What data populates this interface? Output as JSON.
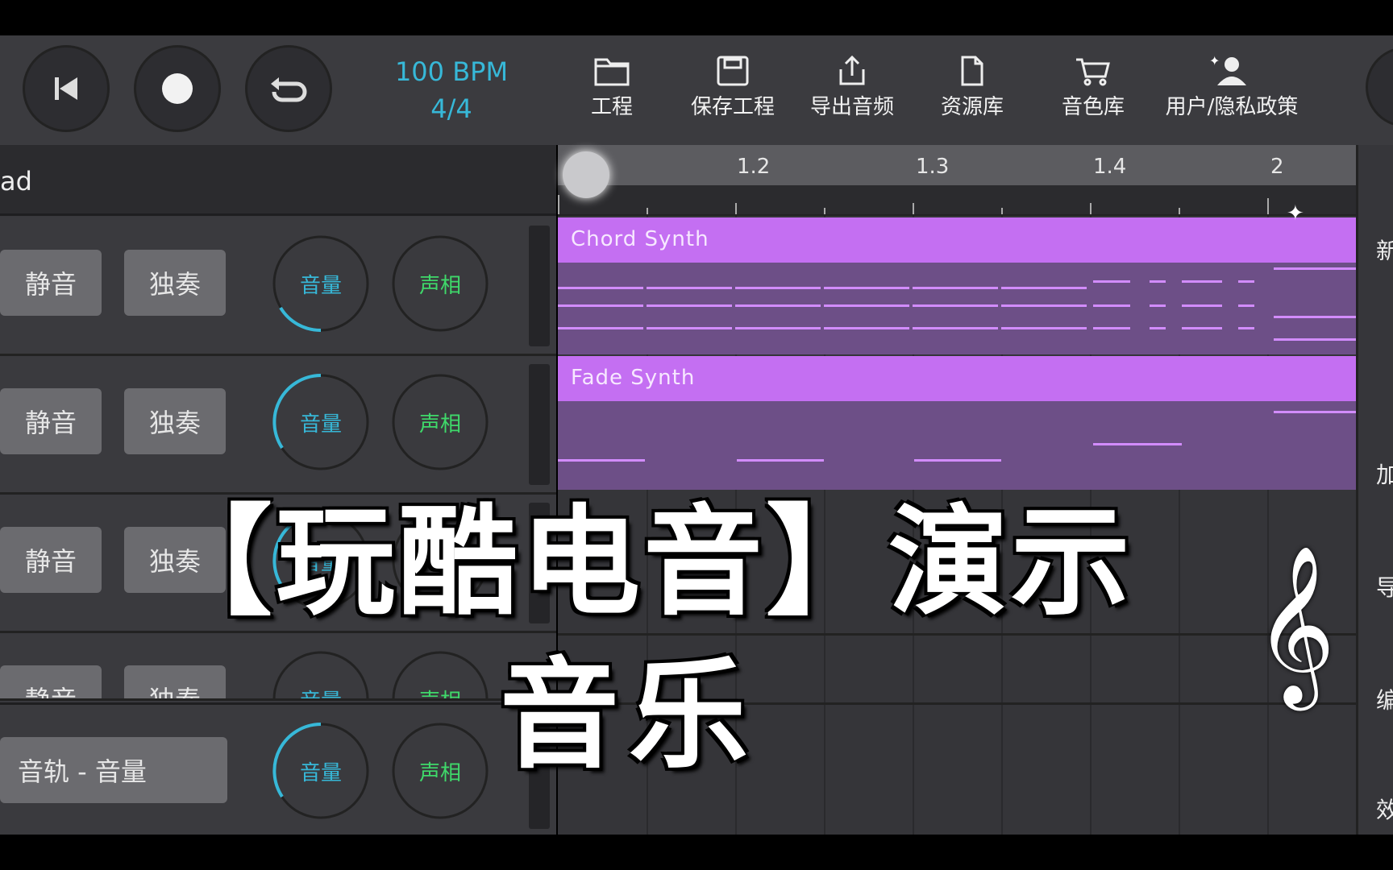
{
  "transport": {
    "bpm": "100 BPM",
    "time_signature": "4/4"
  },
  "menu": [
    {
      "label": "工程",
      "icon": "folder-icon"
    },
    {
      "label": "保存工程",
      "icon": "save-icon"
    },
    {
      "label": "导出音频",
      "icon": "export-icon"
    },
    {
      "label": "资源库",
      "icon": "file-icon"
    },
    {
      "label": "音色库",
      "icon": "cart-icon"
    },
    {
      "label": "用户/隐私政策",
      "icon": "user-icon"
    }
  ],
  "preset": {
    "label": "ad"
  },
  "tracks": [
    {
      "mute": "静音",
      "solo": "独奏",
      "volume": "音量",
      "pan": "声相"
    },
    {
      "mute": "静音",
      "solo": "独奏",
      "volume": "音量",
      "pan": "声相"
    },
    {
      "mute": "静音",
      "solo": "独奏",
      "volume": "音量",
      "pan": "声相"
    },
    {
      "mute": "静音",
      "solo": "独奏",
      "volume": "音量",
      "pan": "声相"
    }
  ],
  "master": {
    "label": "音轨 - 音量",
    "volume": "音量",
    "pan": "声相"
  },
  "ruler": {
    "marks": [
      "1.2",
      "1.3",
      "1.4",
      "2"
    ]
  },
  "clips": [
    {
      "name": "Chord Synth"
    },
    {
      "name": "Fade Synth"
    }
  ],
  "right_panel": [
    "新",
    "加",
    "导",
    "编",
    "效"
  ],
  "overlay": {
    "line1": "【玩酷电音】演示",
    "line2": "音乐"
  },
  "colors": {
    "accent": "#37b8d8",
    "clip": "#c46ff2",
    "pan_text": "#3fd96a"
  }
}
